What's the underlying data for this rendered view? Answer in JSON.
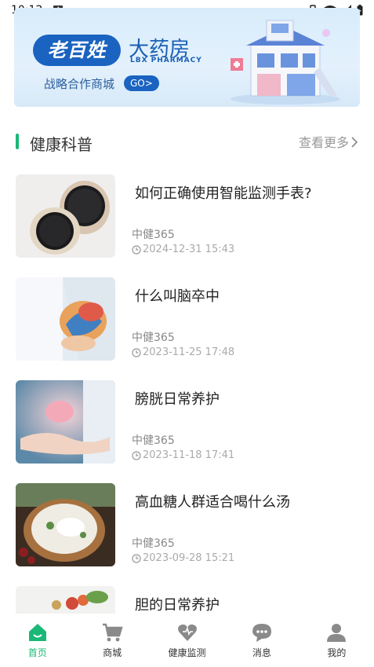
{
  "status_bar": {
    "time": "10:12",
    "notif_letter": "A"
  },
  "banner": {
    "brand_logo": "老百姓",
    "brand_cn": "大药房",
    "brand_en": "LBX PHARMACY",
    "subtitle": "战略合作商城",
    "go_label": "GO>"
  },
  "section": {
    "title": "健康科普",
    "more": "查看更多"
  },
  "articles": [
    {
      "title": "如何正确使用智能监测手表?",
      "source": "中健365",
      "time": "2024-12-31 15:43"
    },
    {
      "title": "什么叫脑卒中",
      "source": "中健365",
      "time": "2023-11-25 17:48"
    },
    {
      "title": "膀胱日常养护",
      "source": "中健365",
      "time": "2023-11-18 17:41"
    },
    {
      "title": "高血糖人群适合喝什么汤",
      "source": "中健365",
      "time": "2023-09-28 15:21"
    },
    {
      "title": "胆的日常养护"
    }
  ],
  "tabbar": {
    "items": [
      {
        "label": "首页",
        "icon": "home-icon",
        "active": true
      },
      {
        "label": "商城",
        "icon": "cart-icon",
        "active": false
      },
      {
        "label": "健康监测",
        "icon": "heart-icon",
        "active": false
      },
      {
        "label": "消息",
        "icon": "chat-icon",
        "active": false
      },
      {
        "label": "我的",
        "icon": "person-icon",
        "active": false
      }
    ]
  },
  "colors": {
    "accent": "#1ab877",
    "brand_blue": "#1a63c0",
    "banner_bg": "#dcedfb"
  }
}
